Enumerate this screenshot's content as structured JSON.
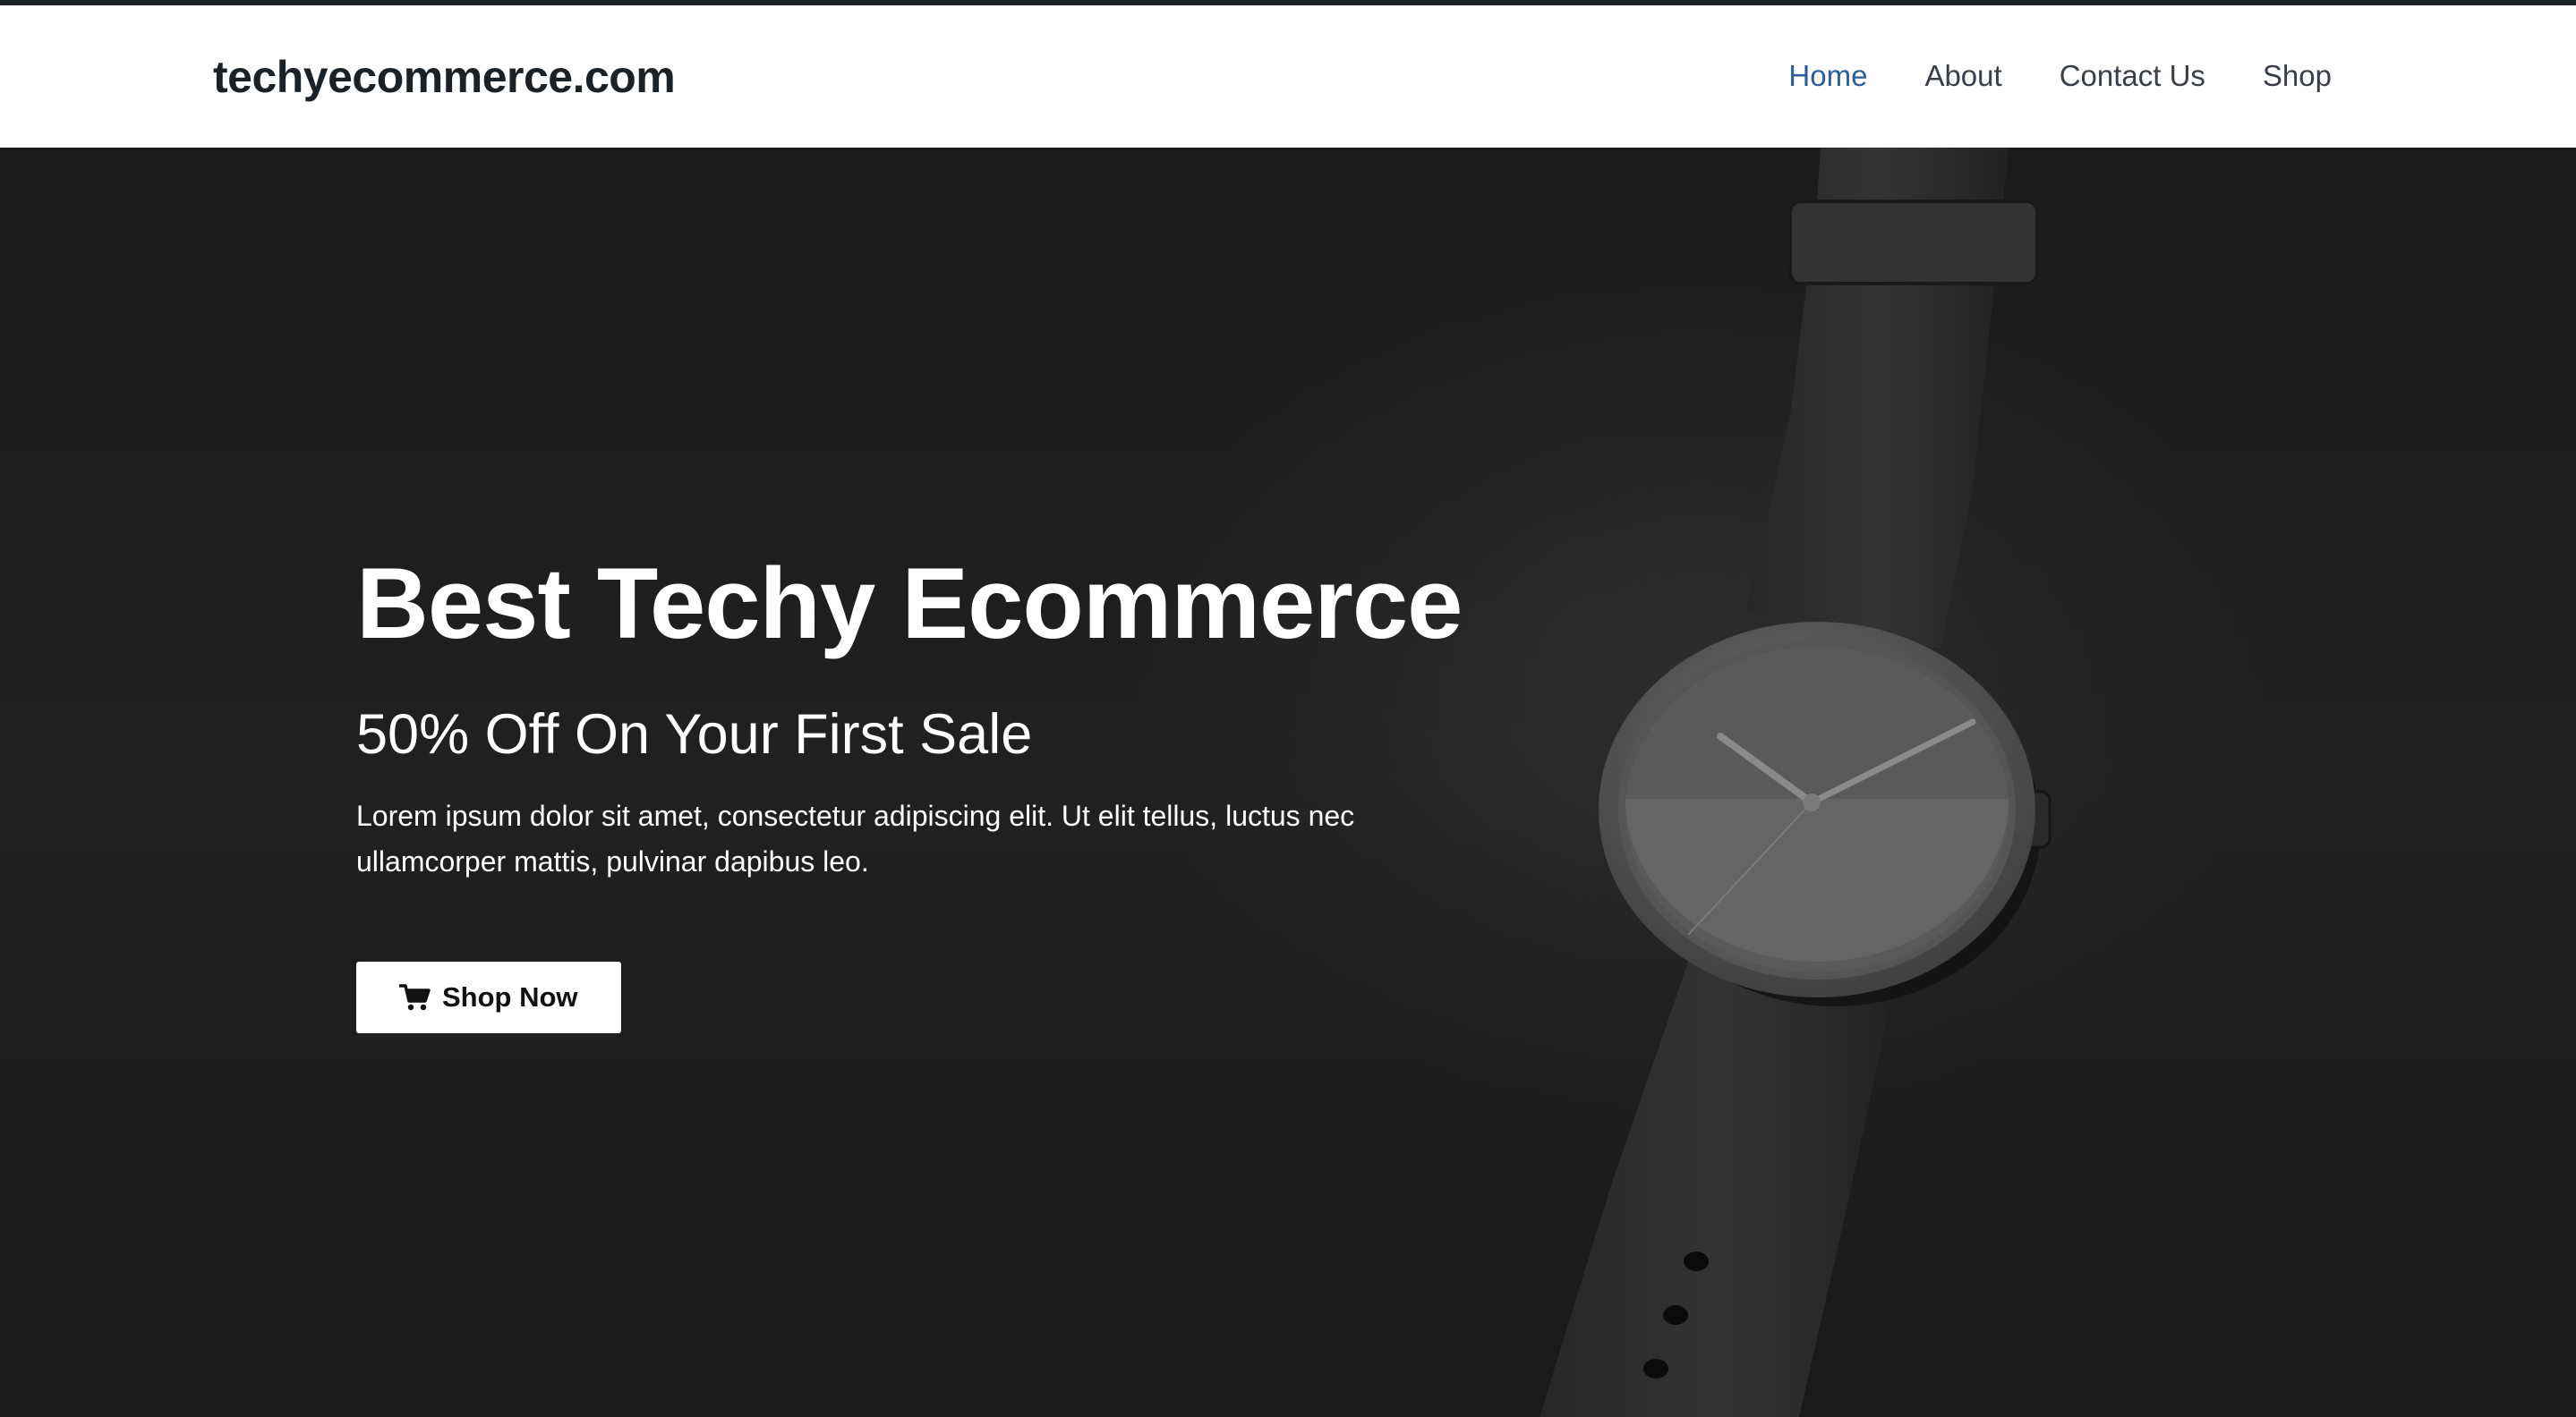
{
  "header": {
    "site_title": "techyecommerce.com",
    "nav": [
      {
        "label": "Home",
        "active": true
      },
      {
        "label": "About",
        "active": false
      },
      {
        "label": "Contact Us",
        "active": false
      },
      {
        "label": "Shop",
        "active": false
      }
    ]
  },
  "hero": {
    "heading": "Best Techy Ecommerce",
    "subheading": "50% Off On Your First Sale",
    "text": "Lorem ipsum dolor sit amet, consectetur adipiscing elit. Ut elit tellus, luctus nec ullamcorper mattis, pulvinar dapibus leo.",
    "cta": {
      "label": "Shop Now",
      "icon": "shopping-cart-icon"
    },
    "image": "wristwatch"
  },
  "colors": {
    "nav_active": "#2b5d9c",
    "nav_text": "#3a3f47",
    "hero_background": "#1c1c1c",
    "button_background": "#ffffff"
  }
}
